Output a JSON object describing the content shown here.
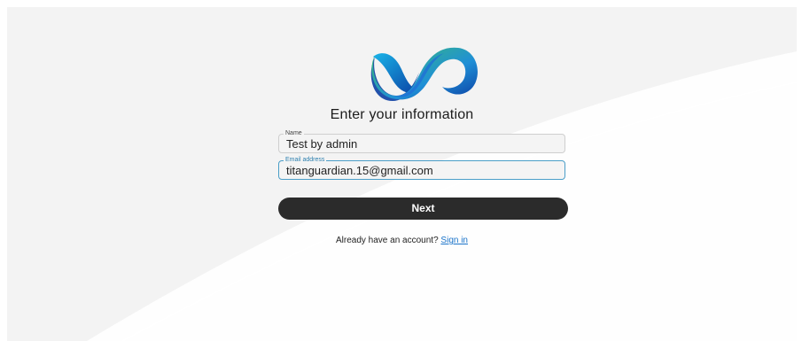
{
  "logo": {
    "icon": "webex-logo-icon",
    "colors": {
      "blue": "#1f6fd6",
      "cyan": "#19b4e8",
      "green": "#3fc46b",
      "dark_blue": "#0b3fa3"
    }
  },
  "form": {
    "title": "Enter your information",
    "name_field": {
      "label": "Name",
      "value": "Test by admin"
    },
    "email_field": {
      "label": "Email address",
      "value": "titanguardian.15@gmail.com"
    },
    "next_label": "Next"
  },
  "signin": {
    "prompt": "Already have an account?",
    "link_label": "Sign in"
  },
  "colors": {
    "button_bg": "#2b2b2b",
    "focus_border": "#4a9ec8",
    "link": "#1a73c9"
  }
}
